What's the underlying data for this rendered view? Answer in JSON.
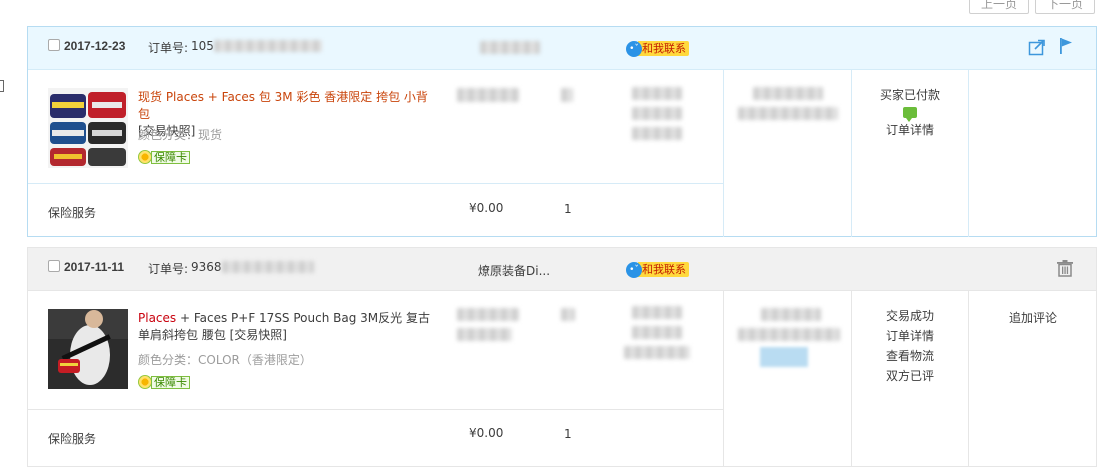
{
  "pager": {
    "prev": "上一页",
    "next": "下一页"
  },
  "orders": [
    {
      "date": "2017-12-23",
      "order_label": "订单号:",
      "order_no_prefix": "105",
      "contact_label": "和我联系",
      "product": {
        "title_part1": "现货 Places + Faces 包 3M 彩色 香港限定 挎包 小背包",
        "title_part2": "[交易快照]",
        "color_category": "颜色分类：现货",
        "badge": "保障卡"
      },
      "insurance": "保险服务",
      "insurance_price": "¥0.00",
      "insurance_qty": "1",
      "status_text": "买家已付款",
      "status_detail": "订单详情"
    },
    {
      "date": "2017-11-11",
      "order_label": "订单号:",
      "order_no_prefix": "9368",
      "shop_name": "燎原装备Di...",
      "contact_label": "和我联系",
      "product": {
        "title_red": "Places",
        "title_rest": " + Faces P+F 17SS Pouch Bag 3M反光 复古单肩斜挎包 腰包 [交易快照]",
        "color_category": "颜色分类：COLOR（香港限定）",
        "badge": "保障卡"
      },
      "insurance": "保险服务",
      "insurance_price": "¥0.00",
      "insurance_qty": "1",
      "status_lines": [
        "交易成功",
        "订单详情",
        "查看物流",
        "双方已评"
      ],
      "action": "追加评论"
    }
  ],
  "colors": {
    "accent_blue": "#2b93e6",
    "title_orange": "#c9440b",
    "title_red": "#c9000d",
    "header_blue": "#eaf8ff"
  },
  "icons": [
    "share-icon",
    "flag-icon",
    "trash-icon",
    "chat-bubble-icon",
    "message-icon",
    "guarantee-flower-icon"
  ]
}
